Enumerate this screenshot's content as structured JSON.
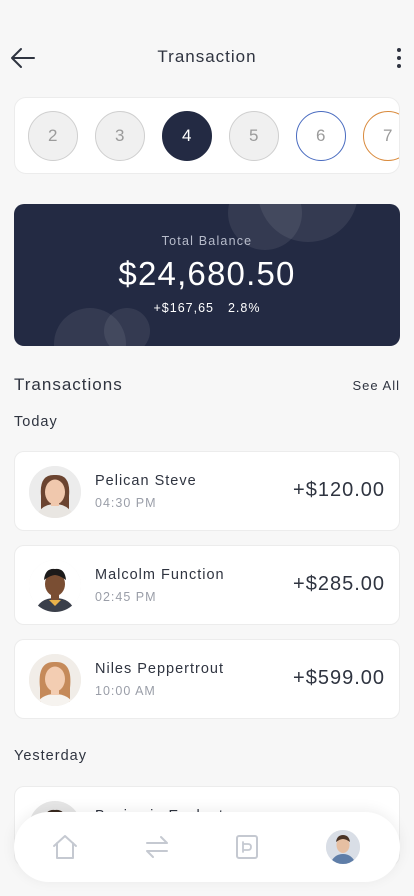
{
  "header": {
    "title": "Transaction"
  },
  "steps": [
    "2",
    "3",
    "4",
    "5",
    "6",
    "7"
  ],
  "balance": {
    "label": "Total Balance",
    "amount": "$24,680.50",
    "change": "+$167,65",
    "percent": "2.8%"
  },
  "transactions_section": {
    "title": "Transactions",
    "see_all": "See All"
  },
  "groups": {
    "today": {
      "label": "Today",
      "items": [
        {
          "name": "Pelican Steve",
          "time": "04:30 PM",
          "amount": "+$120.00"
        },
        {
          "name": "Malcolm Function",
          "time": "02:45 PM",
          "amount": "+$285.00"
        },
        {
          "name": "Niles Peppertrout",
          "time": "10:00 AM",
          "amount": "+$599.00"
        }
      ]
    },
    "yesterday": {
      "label": "Yesterday",
      "items": [
        {
          "name": "Benjamin Evalent"
        }
      ]
    }
  },
  "tabbar": {
    "icons": [
      "home-icon",
      "transfer-icon",
      "card-icon",
      "profile-avatar"
    ]
  },
  "colors": {
    "accent": "#232a43",
    "step_blue": "#4a6cc0",
    "step_orange": "#d98a3c",
    "background": "#f7f7f7"
  }
}
